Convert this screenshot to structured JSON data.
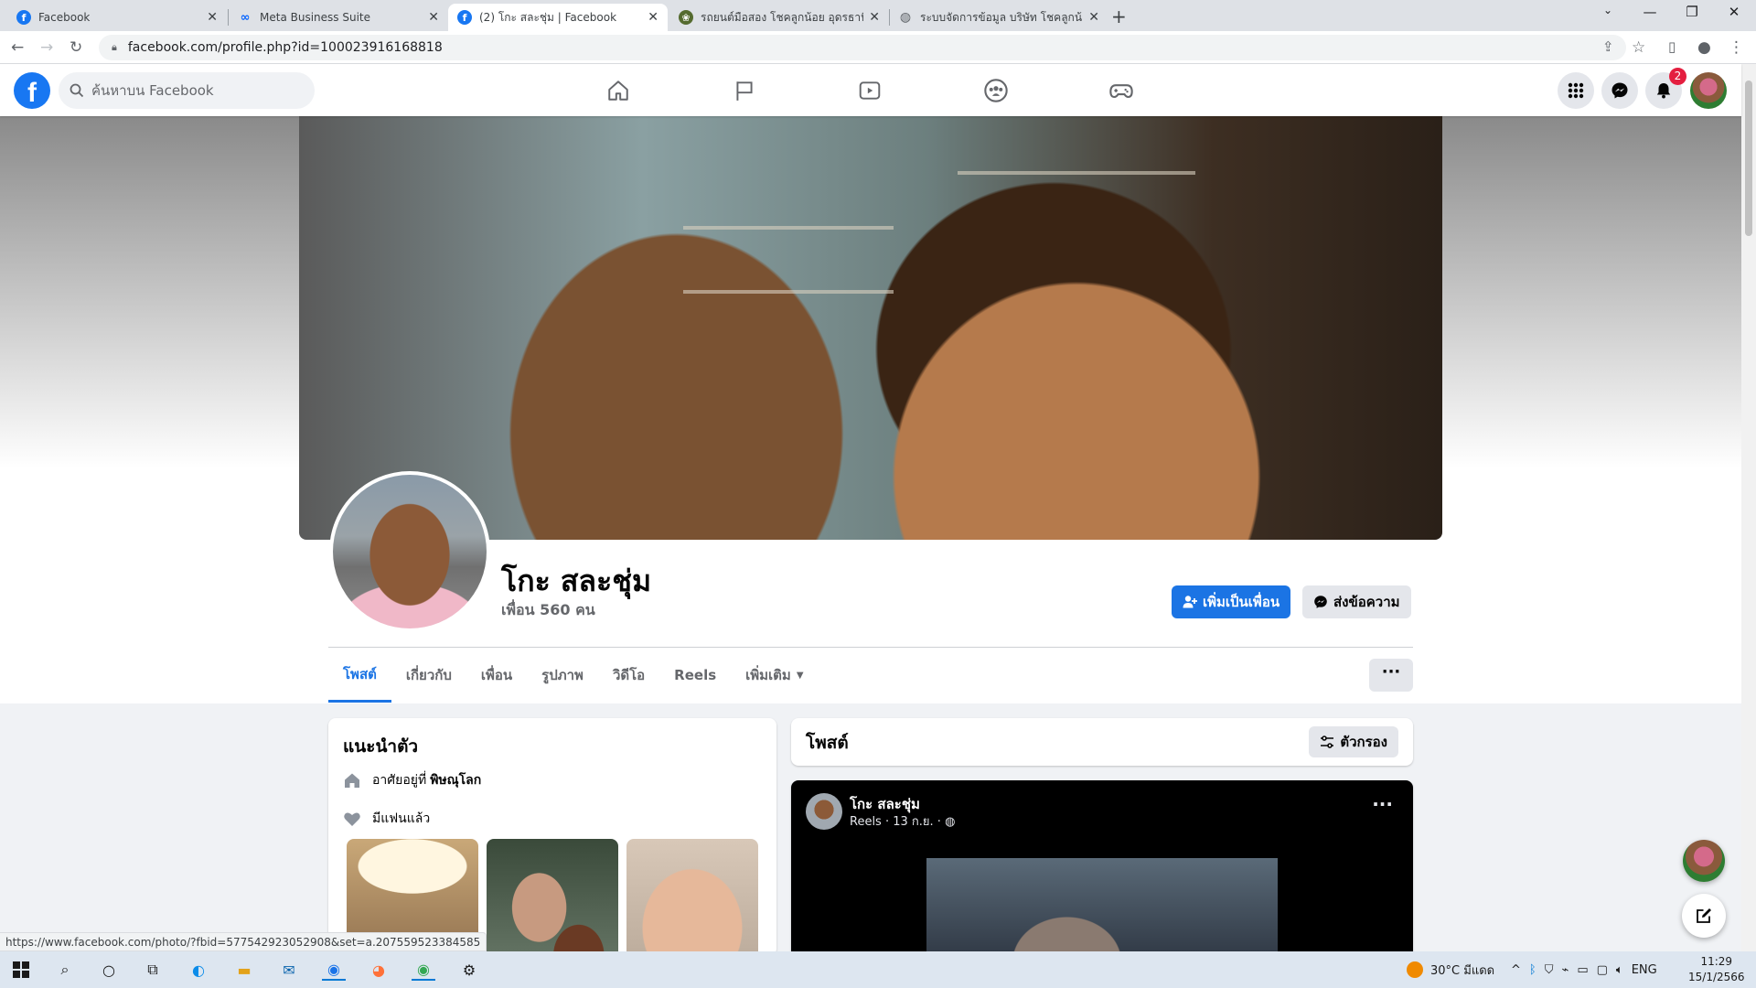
{
  "browser": {
    "tabs": [
      {
        "label": "Facebook",
        "active": false
      },
      {
        "label": "Meta Business Suite",
        "active": false
      },
      {
        "label": "(2) โกะ สละชุ่ม | Facebook",
        "active": true
      },
      {
        "label": "รถยนต์มือสอง โชคลูกน้อย อุดรธานี",
        "active": false
      },
      {
        "label": "ระบบจัดการข้อมูล บริษัท โชคลูกน้อย ก",
        "active": false
      }
    ],
    "url": "facebook.com/profile.php?id=100023916168818",
    "status_url": "https://www.facebook.com/photo/?fbid=577542923052908&set=a.207559523384585"
  },
  "fb": {
    "search_placeholder": "ค้นหาบน Facebook",
    "notification_count": "2"
  },
  "profile": {
    "name": "โกะ สละชุ่ม",
    "friends": "เพื่อน 560 คน",
    "add_friend_label": "เพิ่มเป็นเพื่อน",
    "message_label": "ส่งข้อความ",
    "tabs": [
      "โพสต์",
      "เกี่ยวกับ",
      "เพื่อน",
      "รูปภาพ",
      "วิดีโอ",
      "Reels",
      "เพิ่มเติม"
    ],
    "more_dots": "···"
  },
  "intro": {
    "title": "แนะนำตัว",
    "lives_prefix": "อาศัยอยู่ที่",
    "lives_place": "พิษณุโลก",
    "relationship": "มีแฟนแล้ว"
  },
  "posts": {
    "title": "โพสต์",
    "filter_label": "ตัวกรอง",
    "post": {
      "author": "โกะ สละชุ่ม",
      "meta": "Reels · 13 ก.ย. · ",
      "dots": "···"
    }
  },
  "taskbar": {
    "weather": "30°C  มีแดด",
    "lang": "ENG",
    "time": "11:29",
    "date": "15/1/2566"
  },
  "colors": {
    "fb_blue": "#1877f2",
    "button_blue": "#1b74e4",
    "badge_red": "#e41e3f"
  }
}
